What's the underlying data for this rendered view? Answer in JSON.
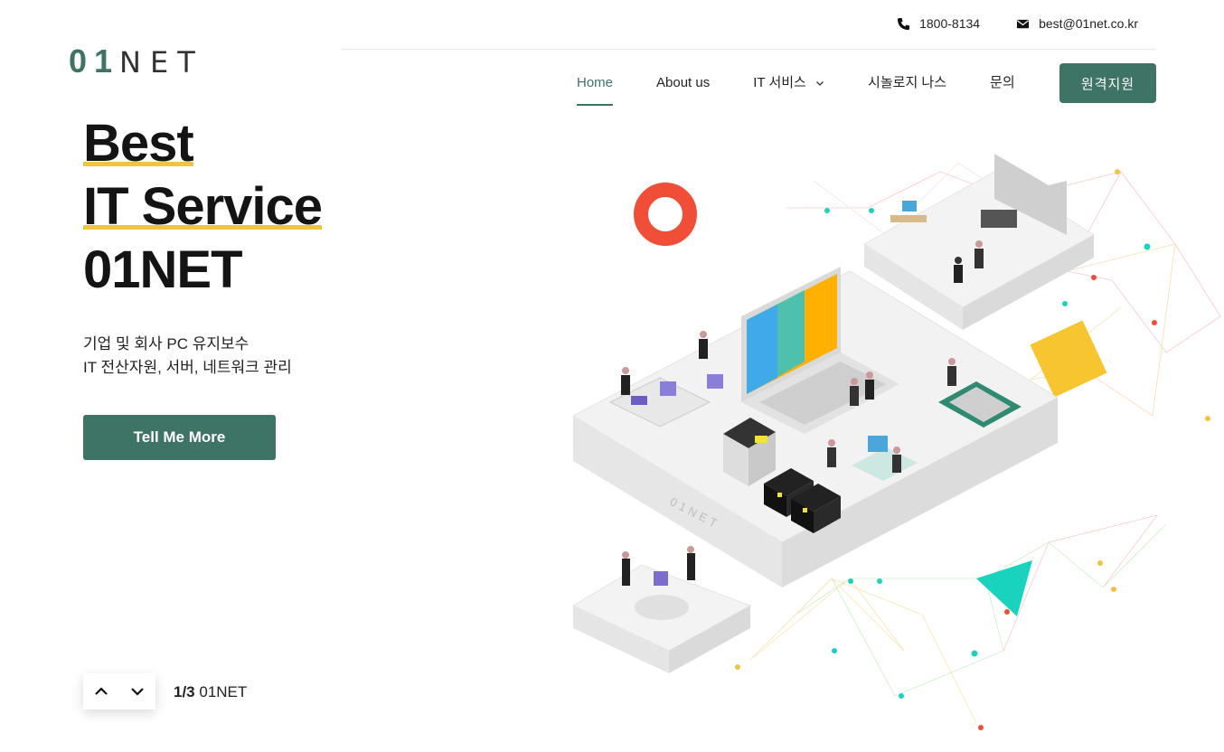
{
  "topbar": {
    "phone": "1800-8134",
    "email": "best@01net.co.kr",
    "phone_icon": "phone-icon",
    "email_icon": "mail-icon"
  },
  "logo": {
    "bold": "01",
    "thin": "NET"
  },
  "nav": {
    "items": [
      {
        "label": "Home",
        "active": true
      },
      {
        "label": "About us"
      },
      {
        "label": "IT 서비스",
        "has_dropdown": true
      },
      {
        "label": "시놀로지 나스"
      },
      {
        "label": "문의"
      }
    ],
    "cta": "원격지원"
  },
  "hero": {
    "line1": "Best",
    "line2": "IT Service",
    "line3": "01NET",
    "sub1": "기업 및 회사 PC 유지보수",
    "sub2": "IT 전산자원, 서버, 네트워크 관리",
    "button": "Tell Me More"
  },
  "slider": {
    "current": "1/3",
    "label": "01NET",
    "prev_icon": "chevron-up-icon",
    "next_icon": "chevron-down-icon"
  },
  "illustration": {
    "platform_label": "01NET",
    "colors": {
      "accent": "#3d7465",
      "highlight": "#f3c340",
      "red": "#f04e37",
      "teal": "#1ad3bf"
    }
  }
}
